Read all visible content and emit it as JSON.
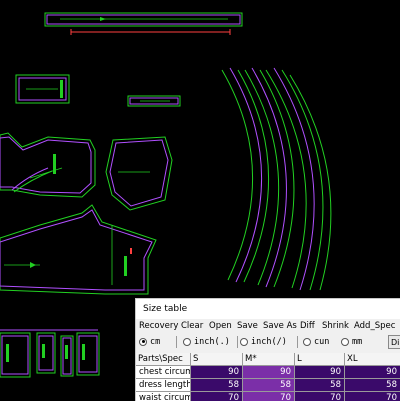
{
  "size_table": {
    "title": "Size table",
    "toolbar": [
      "Recovery",
      "Clear",
      "Open",
      "Save",
      "Save As",
      "Diff",
      "Shrink",
      "Add_Spec"
    ],
    "units": [
      {
        "label": "cm",
        "selected": true
      },
      {
        "label": "inch(.)",
        "selected": false
      },
      {
        "label": "inch(/)",
        "selected": false
      },
      {
        "label": "cun",
        "selected": false
      },
      {
        "label": "mm",
        "selected": false
      }
    ],
    "dis_button": "Di",
    "columns": [
      "Parts\\Spec",
      "S",
      "M*",
      "L",
      "XL"
    ],
    "rows": [
      {
        "part": "chest circumf",
        "values": [
          "90",
          "90",
          "90",
          "90"
        ]
      },
      {
        "part": "dress length",
        "values": [
          "58",
          "58",
          "58",
          "58"
        ]
      },
      {
        "part": "waist circumf",
        "values": [
          "70",
          "70",
          "70",
          "70"
        ]
      }
    ],
    "colors": {
      "dark_cell": "#3a0a6a",
      "light_cell": "#7b2fa8",
      "grid_line": "#9a9a9a"
    }
  }
}
